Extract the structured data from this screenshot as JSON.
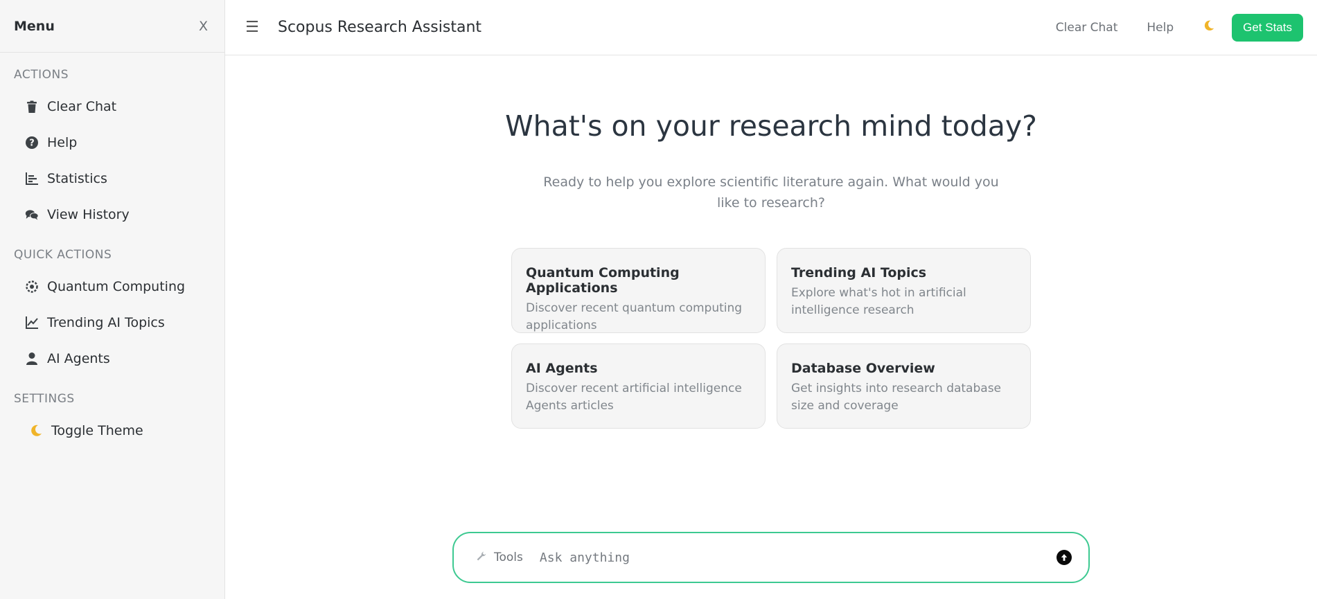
{
  "sidebar": {
    "title": "Menu",
    "close_label": "X",
    "sections": {
      "actions": {
        "heading": "ACTIONS",
        "items": [
          {
            "label": "Clear Chat",
            "icon": "trash-icon"
          },
          {
            "label": "Help",
            "icon": "question-circle-icon"
          },
          {
            "label": "Statistics",
            "icon": "bar-chart-icon"
          },
          {
            "label": "View History",
            "icon": "chat-bubbles-icon"
          }
        ]
      },
      "quick_actions": {
        "heading": "QUICK ACTIONS",
        "items": [
          {
            "label": "Quantum Computing",
            "icon": "atom-icon"
          },
          {
            "label": "Trending AI Topics",
            "icon": "line-chart-icon"
          },
          {
            "label": "AI Agents",
            "icon": "user-icon"
          }
        ]
      },
      "settings": {
        "heading": "SETTINGS",
        "items": [
          {
            "label": "Toggle Theme",
            "icon": "moon-icon"
          }
        ]
      }
    }
  },
  "topbar": {
    "menu_icon": "☰",
    "title": "Scopus Research Assistant",
    "clear_chat": "Clear Chat",
    "help": "Help",
    "theme_icon": "🌙",
    "stats_button": "Get Stats"
  },
  "main": {
    "heading": "What's on your research mind today?",
    "subheading": "Ready to help you explore scientific literature again. What would you like to research?",
    "cards": [
      {
        "title": "Quantum Computing Applications",
        "desc": "Discover recent quantum computing applications"
      },
      {
        "title": "Trending AI Topics",
        "desc": "Explore what's hot in artificial intelligence research"
      },
      {
        "title": "AI Agents",
        "desc": "Discover recent artificial intelligence Agents articles"
      },
      {
        "title": "Database Overview",
        "desc": "Get insights into research database size and coverage"
      }
    ]
  },
  "composer": {
    "tools_label": "Tools",
    "tools_icon": "🔧",
    "placeholder": "Ask anything",
    "value": ""
  },
  "colors": {
    "accent": "#1dc36f",
    "input_border": "#3dc991",
    "sidebar_bg": "#f6f6f6"
  }
}
